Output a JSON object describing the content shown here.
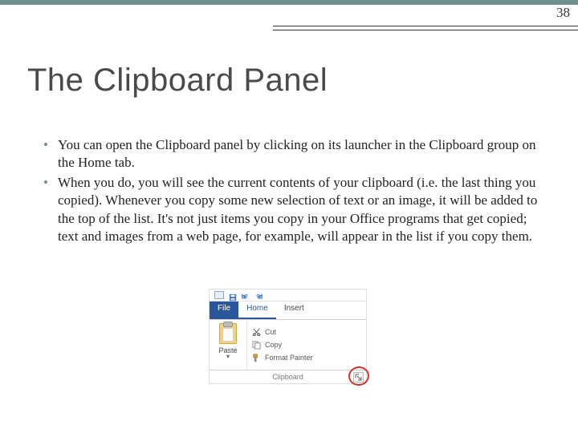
{
  "page_number": "38",
  "title": "The Clipboard Panel",
  "bullets": [
    "You can open the Clipboard panel by clicking on its launcher in the Clipboard group on the Home tab.",
    "When you do, you will see the current contents of your clipboard (i.e. the last thing you copied). Whenever you copy some new selection of text or an image, it will be added to the top of the list. It's not just items you copy in your Office programs that get copied; text and images from a web page, for example, will appear in the list if you copy them."
  ],
  "ribbon": {
    "file_tab": "File",
    "tabs": {
      "home": "Home",
      "insert": "Insert"
    },
    "paste_label": "Paste",
    "cut_label": "Cut",
    "copy_label": "Copy",
    "format_painter_label": "Format Painter",
    "group_label": "Clipboard"
  }
}
